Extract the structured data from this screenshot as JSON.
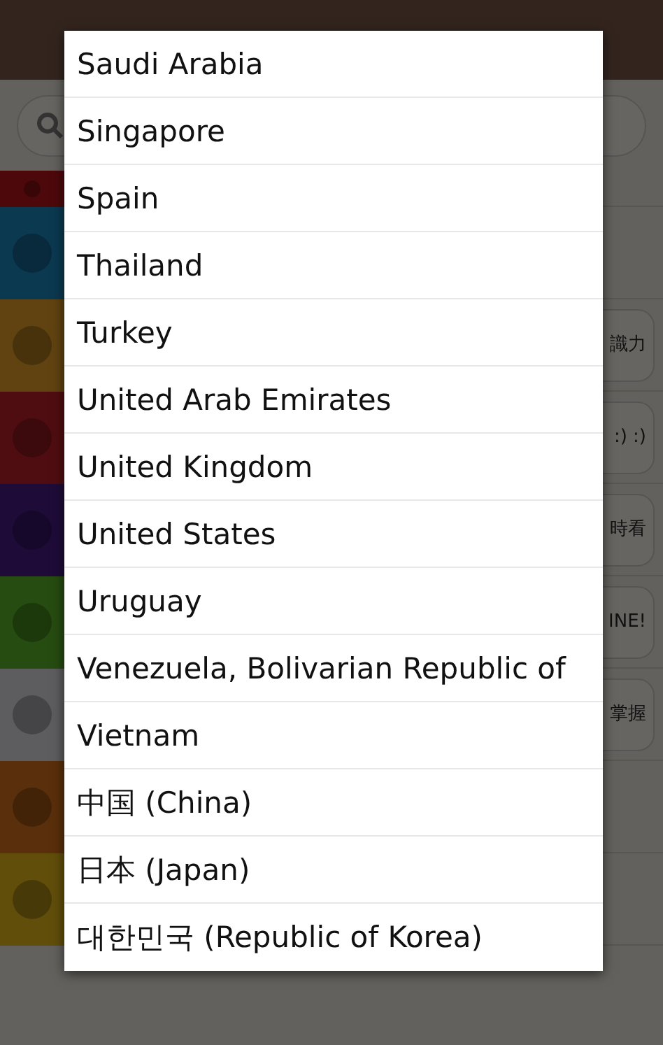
{
  "background": {
    "app_rows": [
      {
        "color": "#4d080b"
      },
      {
        "color": "#0b3950"
      },
      {
        "color": "#604310",
        "snippet": "識力"
      },
      {
        "color": "#500d11",
        "snippet": ":) :)"
      },
      {
        "color": "#1e0b38",
        "snippet": "時看"
      },
      {
        "color": "#264c11",
        "snippet": "INE!"
      },
      {
        "color": "#5d5d60",
        "snippet": "掌握"
      },
      {
        "color": "#5a2f0b"
      },
      {
        "color": "#614e0b"
      }
    ]
  },
  "dialog": {
    "items": [
      {
        "label": "Saudi Arabia"
      },
      {
        "label": "Singapore"
      },
      {
        "label": "Spain"
      },
      {
        "label": "Thailand"
      },
      {
        "label": "Turkey"
      },
      {
        "label": "United Arab Emirates"
      },
      {
        "label": "United Kingdom"
      },
      {
        "label": "United States"
      },
      {
        "label": "Uruguay"
      },
      {
        "label": "Venezuela, Bolivarian Republic of"
      },
      {
        "label": "Vietnam"
      },
      {
        "label": "中国 (China)"
      },
      {
        "label": "日本 (Japan)"
      },
      {
        "label": "대한민국 (Republic of Korea)"
      }
    ]
  }
}
